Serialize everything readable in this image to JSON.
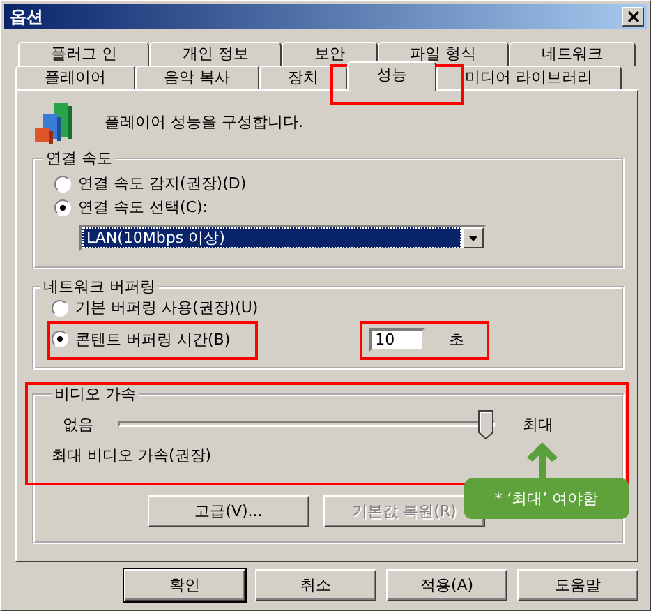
{
  "window": {
    "title": "옵션"
  },
  "tab_rows": [
    {
      "tabs": [
        {
          "label": "플러그 인",
          "selected": false
        },
        {
          "label": "개인 정보",
          "selected": false
        },
        {
          "label": "보안",
          "selected": false
        },
        {
          "label": "파일 형식",
          "selected": false
        },
        {
          "label": "네트워크",
          "selected": false
        }
      ]
    },
    {
      "tabs": [
        {
          "label": "플레이어",
          "selected": false
        },
        {
          "label": "음악 복사",
          "selected": false
        },
        {
          "label": "장치",
          "selected": false
        },
        {
          "label": "성능",
          "selected": true
        },
        {
          "label": "미디어 라이브러리",
          "selected": false
        }
      ]
    }
  ],
  "header": {
    "text": "플레이어 성능을 구성합니다."
  },
  "connection_speed": {
    "title": "연결 속도",
    "options": [
      {
        "label": "연결 속도 감지(권장)(D)",
        "selected": false
      },
      {
        "label": "연결 속도 선택(C):",
        "selected": true
      }
    ],
    "dropdown": {
      "value": "LAN(10Mbps 이상)"
    }
  },
  "network_buffering": {
    "title": "네트워크 버퍼링",
    "options": [
      {
        "label": "기본 버퍼링 사용(권장)(U)",
        "selected": false
      },
      {
        "label": "콘텐트 버퍼링 시간(B)",
        "selected": true
      }
    ],
    "buffer_time": {
      "value": "10",
      "unit": "초"
    }
  },
  "video_acceleration": {
    "title": "비디오 가속",
    "min_label": "없음",
    "max_label": "최대",
    "level": 1,
    "description": "최대 비디오 가속(권장)",
    "buttons": [
      {
        "label": "고급(V)...",
        "disabled": false
      },
      {
        "label": "기본값 복원(R)",
        "disabled": true
      }
    ]
  },
  "buttons": [
    {
      "label": "확인",
      "default": true
    },
    {
      "label": "취소",
      "default": false
    },
    {
      "label": "적용(A)",
      "default": false
    },
    {
      "label": "도움말",
      "default": false
    }
  ],
  "callout": {
    "text": "* ‘최대’ 여야함"
  }
}
